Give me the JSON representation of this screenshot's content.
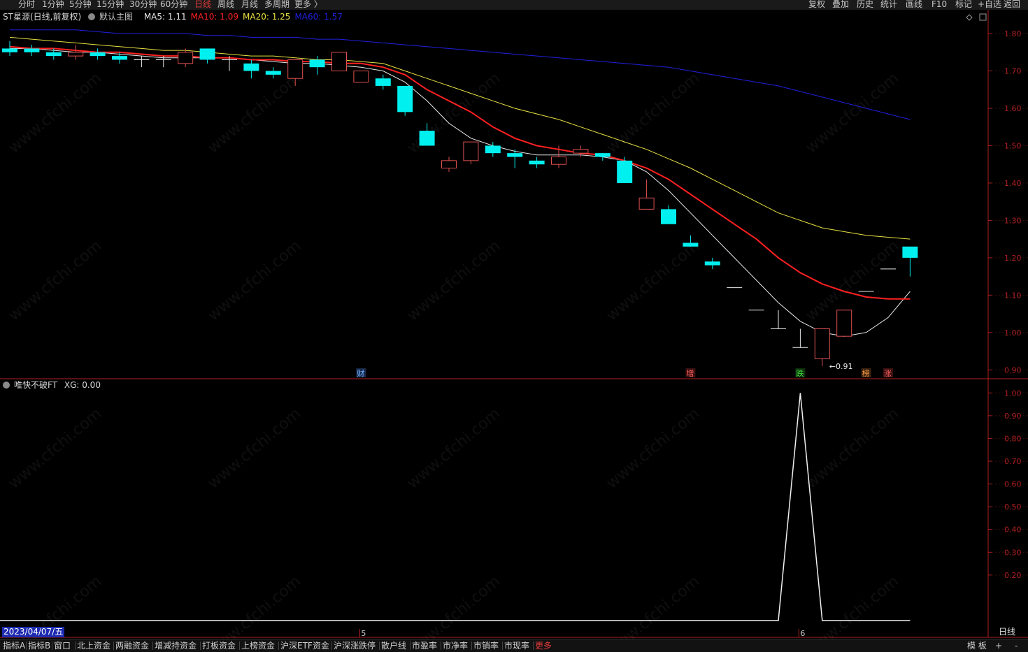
{
  "topbar": {
    "period_tabs": [
      "分时",
      "1分钟",
      "5分钟",
      "15分钟",
      "30分钟",
      "60分钟",
      "日线",
      "周线",
      "月线",
      "多周期",
      "更多 〉"
    ],
    "active_tab": "日线",
    "tools": [
      "复权",
      "叠加",
      "历史",
      "统计",
      "画线",
      "F10",
      "标记",
      "+自选",
      "返回"
    ]
  },
  "main_panel": {
    "stock": "ST星源(日线,前复权)",
    "template": "默认主图",
    "ma": [
      {
        "label": "MA5: 1.11",
        "color": "#e8e8e8"
      },
      {
        "label": "MA10: 1.09",
        "color": "#ff2020"
      },
      {
        "label": "MA20: 1.25",
        "color": "#e8e040"
      },
      {
        "label": "MA60: 1.57",
        "color": "#2020e0"
      }
    ],
    "low_annotation": "←0.91",
    "markers": [
      {
        "text": "财",
        "color": "#6ab0ff",
        "bg": "#1a2a4a",
        "index": 16
      },
      {
        "text": "增",
        "color": "#ff6060",
        "bg": "#3a1010",
        "index": 31
      },
      {
        "text": "跌",
        "color": "#40e040",
        "bg": "#0e300e",
        "index": 36
      },
      {
        "text": "榜",
        "color": "#ff9a40",
        "bg": "#3a2210",
        "index": 39
      },
      {
        "text": "涨",
        "color": "#ff6060",
        "bg": "#3a1010",
        "index": 40
      }
    ]
  },
  "sub_panel": {
    "indicator": "唯快不破FT",
    "value_label": "XG: 0.00"
  },
  "axis": {
    "main_ticks": [
      "1.80",
      "1.70",
      "1.60",
      "1.50",
      "1.40",
      "1.30",
      "1.20",
      "1.10",
      "1.00",
      "0.90"
    ],
    "sub_ticks": [
      "1.00",
      "0.90",
      "0.80",
      "0.70",
      "0.60",
      "0.50",
      "0.40",
      "0.30",
      "0.20"
    ],
    "date_label": "2023/04/07/五",
    "month_markers": [
      {
        "label": "5",
        "index": 16
      },
      {
        "label": "6",
        "index": 36
      }
    ],
    "period_label": "日线"
  },
  "bottom_tabs": [
    "指标A",
    "指标B",
    "窗口",
    "北上资金",
    "两融资金",
    "增减持资金",
    "打板资金",
    "上榜资金",
    "沪深ETF资金",
    "沪深涨跌停",
    "散户线",
    "市盈率",
    "市净率",
    "市销率",
    "市现率",
    "更多"
  ],
  "bottom_right": [
    "模 板",
    "+",
    "-"
  ],
  "watermark": "www.cfchi.com",
  "colors": {
    "up": "#e05050",
    "down": "#00f0f0",
    "flat": "#e8e8e8",
    "axis": "#b02020"
  },
  "chart_data": {
    "type": "candlestick",
    "ylim": [
      0.88,
      1.83
    ],
    "sub_ylim": [
      0,
      1.05
    ],
    "candles": [
      {
        "o": 1.76,
        "h": 1.78,
        "l": 1.74,
        "c": 1.75
      },
      {
        "o": 1.76,
        "h": 1.77,
        "l": 1.74,
        "c": 1.75
      },
      {
        "o": 1.75,
        "h": 1.76,
        "l": 1.73,
        "c": 1.74
      },
      {
        "o": 1.74,
        "h": 1.77,
        "l": 1.73,
        "c": 1.75
      },
      {
        "o": 1.75,
        "h": 1.76,
        "l": 1.73,
        "c": 1.74
      },
      {
        "o": 1.74,
        "h": 1.75,
        "l": 1.72,
        "c": 1.73
      },
      {
        "o": 1.73,
        "h": 1.74,
        "l": 1.71,
        "c": 1.73
      },
      {
        "o": 1.73,
        "h": 1.74,
        "l": 1.71,
        "c": 1.73
      },
      {
        "o": 1.72,
        "h": 1.76,
        "l": 1.71,
        "c": 1.75
      },
      {
        "o": 1.76,
        "h": 1.76,
        "l": 1.72,
        "c": 1.73
      },
      {
        "o": 1.73,
        "h": 1.74,
        "l": 1.7,
        "c": 1.73
      },
      {
        "o": 1.72,
        "h": 1.73,
        "l": 1.68,
        "c": 1.7
      },
      {
        "o": 1.7,
        "h": 1.71,
        "l": 1.68,
        "c": 1.69
      },
      {
        "o": 1.68,
        "h": 1.73,
        "l": 1.66,
        "c": 1.73
      },
      {
        "o": 1.73,
        "h": 1.74,
        "l": 1.69,
        "c": 1.71
      },
      {
        "o": 1.7,
        "h": 1.75,
        "l": 1.7,
        "c": 1.75
      },
      {
        "o": 1.67,
        "h": 1.7,
        "l": 1.67,
        "c": 1.7
      },
      {
        "o": 1.68,
        "h": 1.69,
        "l": 1.65,
        "c": 1.66
      },
      {
        "o": 1.66,
        "h": 1.66,
        "l": 1.58,
        "c": 1.59
      },
      {
        "o": 1.54,
        "h": 1.56,
        "l": 1.5,
        "c": 1.5
      },
      {
        "o": 1.44,
        "h": 1.47,
        "l": 1.43,
        "c": 1.46
      },
      {
        "o": 1.46,
        "h": 1.51,
        "l": 1.45,
        "c": 1.51
      },
      {
        "o": 1.5,
        "h": 1.51,
        "l": 1.47,
        "c": 1.48
      },
      {
        "o": 1.48,
        "h": 1.49,
        "l": 1.44,
        "c": 1.47
      },
      {
        "o": 1.46,
        "h": 1.47,
        "l": 1.44,
        "c": 1.45
      },
      {
        "o": 1.45,
        "h": 1.5,
        "l": 1.44,
        "c": 1.47
      },
      {
        "o": 1.48,
        "h": 1.5,
        "l": 1.47,
        "c": 1.49
      },
      {
        "o": 1.48,
        "h": 1.48,
        "l": 1.46,
        "c": 1.47
      },
      {
        "o": 1.46,
        "h": 1.47,
        "l": 1.4,
        "c": 1.4
      },
      {
        "o": 1.33,
        "h": 1.41,
        "l": 1.33,
        "c": 1.36
      },
      {
        "o": 1.33,
        "h": 1.34,
        "l": 1.29,
        "c": 1.29
      },
      {
        "o": 1.24,
        "h": 1.26,
        "l": 1.23,
        "c": 1.23
      },
      {
        "o": 1.19,
        "h": 1.2,
        "l": 1.17,
        "c": 1.18
      },
      {
        "o": 1.12,
        "h": 1.12,
        "l": 1.12,
        "c": 1.12
      },
      {
        "o": 1.06,
        "h": 1.06,
        "l": 1.06,
        "c": 1.06
      },
      {
        "o": 1.01,
        "h": 1.06,
        "l": 1.01,
        "c": 1.01
      },
      {
        "o": 0.96,
        "h": 1.01,
        "l": 0.96,
        "c": 0.96
      },
      {
        "o": 0.93,
        "h": 1.01,
        "l": 0.91,
        "c": 1.01
      },
      {
        "o": 0.99,
        "h": 1.06,
        "l": 0.99,
        "c": 1.06
      },
      {
        "o": 1.11,
        "h": 1.11,
        "l": 1.11,
        "c": 1.11
      },
      {
        "o": 1.17,
        "h": 1.17,
        "l": 1.17,
        "c": 1.17
      },
      {
        "o": 1.23,
        "h": 1.23,
        "l": 1.15,
        "c": 1.2
      }
    ],
    "series": [
      {
        "name": "MA5",
        "color": "#e8e8e8",
        "values": [
          1.76,
          1.76,
          1.755,
          1.75,
          1.75,
          1.745,
          1.74,
          1.735,
          1.735,
          1.735,
          1.735,
          1.73,
          1.725,
          1.72,
          1.72,
          1.715,
          1.71,
          1.7,
          1.67,
          1.62,
          1.56,
          1.52,
          1.5,
          1.485,
          1.475,
          1.475,
          1.475,
          1.47,
          1.46,
          1.43,
          1.38,
          1.32,
          1.26,
          1.2,
          1.14,
          1.08,
          1.03,
          1.0,
          0.99,
          1.0,
          1.04,
          1.11
        ]
      },
      {
        "name": "MA10",
        "color": "#ff2020",
        "values": [
          1.765,
          1.76,
          1.76,
          1.755,
          1.75,
          1.75,
          1.745,
          1.74,
          1.74,
          1.735,
          1.735,
          1.73,
          1.73,
          1.725,
          1.725,
          1.72,
          1.72,
          1.71,
          1.69,
          1.65,
          1.62,
          1.59,
          1.55,
          1.52,
          1.5,
          1.49,
          1.48,
          1.475,
          1.46,
          1.44,
          1.41,
          1.37,
          1.33,
          1.29,
          1.25,
          1.2,
          1.16,
          1.13,
          1.11,
          1.095,
          1.09,
          1.09
        ]
      },
      {
        "name": "MA20",
        "color": "#e8e040",
        "values": [
          1.79,
          1.785,
          1.78,
          1.775,
          1.77,
          1.765,
          1.76,
          1.755,
          1.755,
          1.75,
          1.745,
          1.74,
          1.74,
          1.735,
          1.73,
          1.73,
          1.725,
          1.72,
          1.7,
          1.68,
          1.66,
          1.64,
          1.62,
          1.6,
          1.585,
          1.57,
          1.55,
          1.53,
          1.51,
          1.49,
          1.465,
          1.44,
          1.41,
          1.38,
          1.35,
          1.32,
          1.3,
          1.28,
          1.27,
          1.26,
          1.255,
          1.25
        ]
      },
      {
        "name": "MA60",
        "color": "#2020e0",
        "values": [
          1.81,
          1.81,
          1.81,
          1.81,
          1.805,
          1.8,
          1.8,
          1.8,
          1.8,
          1.795,
          1.795,
          1.79,
          1.79,
          1.79,
          1.785,
          1.785,
          1.78,
          1.775,
          1.77,
          1.765,
          1.76,
          1.755,
          1.75,
          1.745,
          1.74,
          1.735,
          1.73,
          1.725,
          1.72,
          1.715,
          1.71,
          1.7,
          1.69,
          1.68,
          1.67,
          1.66,
          1.645,
          1.63,
          1.615,
          1.6,
          1.585,
          1.57
        ]
      }
    ],
    "xg": [
      0,
      0,
      0,
      0,
      0,
      0,
      0,
      0,
      0,
      0,
      0,
      0,
      0,
      0,
      0,
      0,
      0,
      0,
      0,
      0,
      0,
      0,
      0,
      0,
      0,
      0,
      0,
      0,
      0,
      0,
      0,
      0,
      0,
      0,
      0,
      0,
      1,
      0,
      0,
      0,
      0,
      0
    ]
  }
}
